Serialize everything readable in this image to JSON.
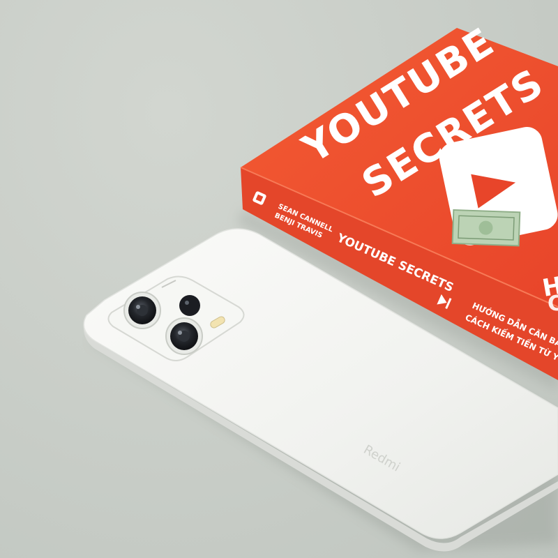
{
  "book": {
    "cover_title_line1": "YOUTUBE",
    "cover_title_line2": "SECRETS",
    "cover_partial_right": "HƯ",
    "spine_author_1": "SEAN CANNELL",
    "spine_author_2": "BENJI TRAVIS",
    "spine_title": "YOUTUBE SECRETS",
    "spine_subtitle_1": "HƯỚNG DẪN CĂN BẢN",
    "spine_subtitle_2": "CÁCH KIẾM TIỀN TỪ YOU",
    "colors": {
      "cover": "#f0512c",
      "spine": "#e8492a",
      "text": "#ffffff"
    }
  },
  "phone": {
    "brand_mark": "Redmi",
    "colors": {
      "body": "#f3f4f1",
      "lens": "#1b1d22"
    }
  }
}
